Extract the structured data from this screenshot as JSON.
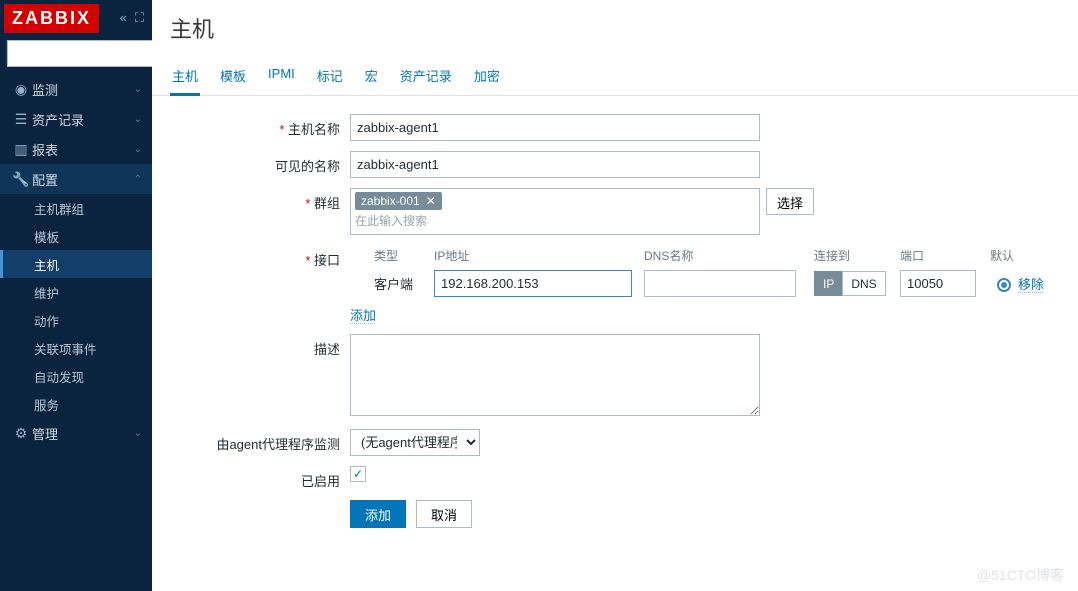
{
  "brand": "ZABBIX",
  "sidebar": {
    "search_placeholder": "",
    "items": [
      {
        "label": "监测"
      },
      {
        "label": "资产记录"
      },
      {
        "label": "报表"
      },
      {
        "label": "配置"
      },
      {
        "label": "管理"
      }
    ],
    "config_sub": [
      {
        "label": "主机群组"
      },
      {
        "label": "模板"
      },
      {
        "label": "主机"
      },
      {
        "label": "维护"
      },
      {
        "label": "动作"
      },
      {
        "label": "关联项事件"
      },
      {
        "label": "自动发现"
      },
      {
        "label": "服务"
      }
    ]
  },
  "page": {
    "title": "主机"
  },
  "tabs": [
    "主机",
    "模板",
    "IPMI",
    "标记",
    "宏",
    "资产记录",
    "加密"
  ],
  "form": {
    "host_name_label": "主机名称",
    "host_name": "zabbix-agent1",
    "visible_name_label": "可见的名称",
    "visible_name": "zabbix-agent1",
    "groups_label": "群组",
    "group_pill": "zabbix-001",
    "group_placeholder": "在此输入搜索",
    "select_btn": "选择",
    "interfaces_label": "接口",
    "iface_head": {
      "type": "类型",
      "ip": "IP地址",
      "dns": "DNS名称",
      "connect": "连接到",
      "port": "端口",
      "default": "默认"
    },
    "iface_row": {
      "type": "客户端",
      "ip": "192.168.200.153",
      "dns": "",
      "conn_ip": "IP",
      "conn_dns": "DNS",
      "port": "10050",
      "remove": "移除"
    },
    "add_link": "添加",
    "desc_label": "描述",
    "desc": "",
    "proxy_label": "由agent代理程序监测",
    "proxy_value": "(无agent代理程序)",
    "enabled_label": "已启用",
    "submit": "添加",
    "cancel": "取消"
  },
  "watermark": "@51CTO博客"
}
